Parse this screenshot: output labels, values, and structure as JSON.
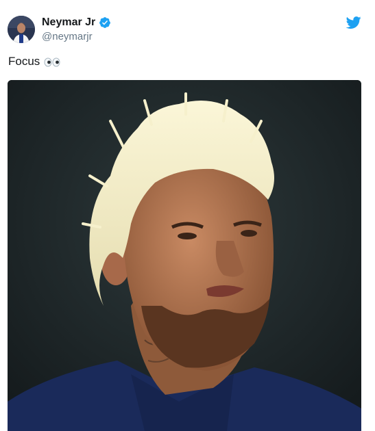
{
  "tweet": {
    "author": {
      "display_name": "Neymar Jr",
      "handle": "@neymarjr",
      "verified": true,
      "avatar_icon": "profile-photo-icon"
    },
    "text": "Focus",
    "emoji_icon": "eyes-emoji-icon",
    "brand_icon": "twitter-bird-icon",
    "media_icon": "photo-portrait-icon"
  },
  "colors": {
    "brand": "#1da1f2",
    "verified": "#1da1f2",
    "text": "#14171a",
    "secondary_text": "#657786"
  }
}
